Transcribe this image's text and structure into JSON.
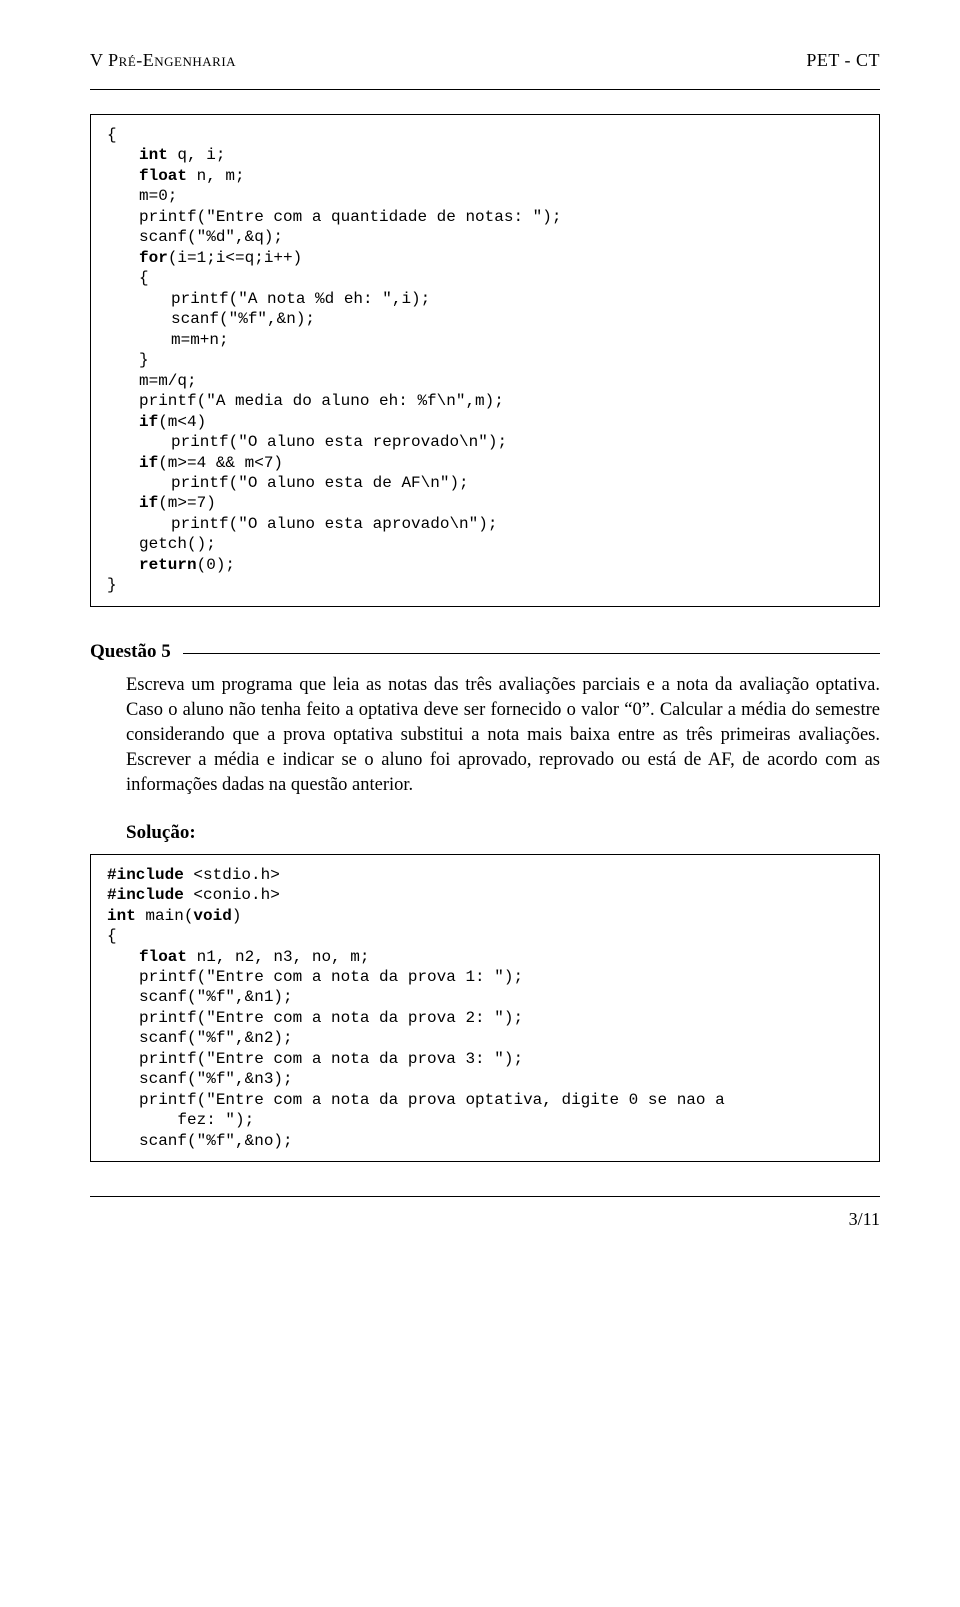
{
  "header": {
    "left": "V Pré-Engenharia",
    "right": "PET - CT"
  },
  "code1": {
    "l1": "{",
    "l2_a": "int",
    "l2_b": " q, i;",
    "l3_a": "float",
    "l3_b": " n, m;",
    "l4": "m=0;",
    "l5": "printf(\"Entre com a quantidade de notas: \");",
    "l6": "scanf(\"%d\",&q);",
    "l7_a": "for",
    "l7_b": "(i=1;i<=q;i++)",
    "l8": "{",
    "l9": "printf(\"A nota %d eh: \",i);",
    "l10": "scanf(\"%f\",&n);",
    "l11": "m=m+n;",
    "l12": "}",
    "l13": "m=m/q;",
    "l14": "printf(\"A media do aluno eh: %f\\n\",m);",
    "l15_a": "if",
    "l15_b": "(m<4)",
    "l16": "printf(\"O aluno esta reprovado\\n\");",
    "l17_a": "if",
    "l17_b": "(m>=4 && m<7)",
    "l18": "printf(\"O aluno esta de AF\\n\");",
    "l19_a": "if",
    "l19_b": "(m>=7)",
    "l20": "printf(\"O aluno esta aprovado\\n\");",
    "l21": "getch();",
    "l22_a": "return",
    "l22_b": "(0);",
    "l23": "}"
  },
  "question": {
    "label": "Questão 5",
    "body": "Escreva um programa que leia as notas das três avaliações parciais e a nota da avaliação optativa. Caso o aluno não tenha feito a optativa deve ser fornecido o valor “0”. Calcular a média do semestre considerando que a prova optativa substitui a nota mais baixa entre as três primeiras avaliações. Escrever a média e indicar se o aluno foi aprovado, reprovado ou está de AF, de acordo com as informações dadas na questão anterior."
  },
  "solution_label": "Solução:",
  "code2": {
    "l1_a": "#include",
    "l1_b": " <stdio.h>",
    "l2_a": "#include",
    "l2_b": " <conio.h>",
    "l3_a": "int",
    "l3_b": " main(",
    "l3_c": "void",
    "l3_d": ")",
    "l4": "{",
    "l5_a": "float",
    "l5_b": " n1, n2, n3, no, m;",
    "l6": "printf(\"Entre com a nota da prova 1: \");",
    "l7": "scanf(\"%f\",&n1);",
    "l8": "printf(\"Entre com a nota da prova 2: \");",
    "l9": "scanf(\"%f\",&n2);",
    "l10": "printf(\"Entre com a nota da prova 3: \");",
    "l11": "scanf(\"%f\",&n3);",
    "l12": "printf(\"Entre com a nota da prova optativa, digite 0 se nao a",
    "l12b": "    fez: \");",
    "l13": "scanf(\"%f\",&no);"
  },
  "footer": {
    "page": "3/11"
  }
}
